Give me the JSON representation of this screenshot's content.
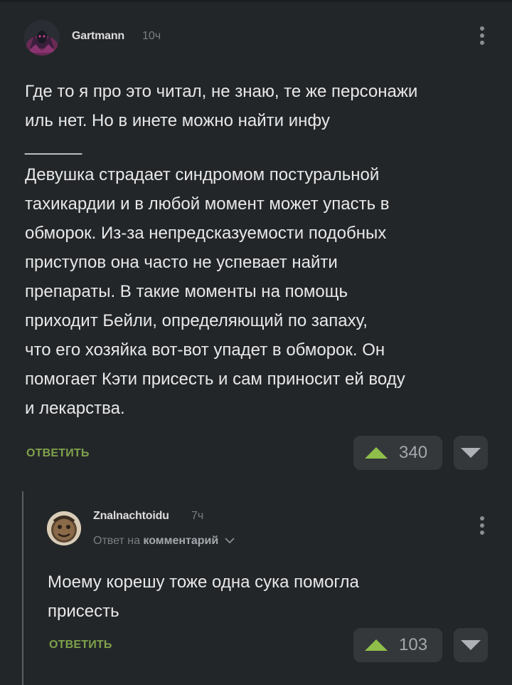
{
  "colors": {
    "background": "#232629",
    "accent_green": "#7fa14b",
    "vote_button_bg": "#34383b",
    "thread_line": "#5a5e61"
  },
  "comments": [
    {
      "author": "Gartmann",
      "time": "10ч",
      "body": [
        "Где то я про это читал, не знаю, те же персонажи",
        "иль нет. Но в инете можно найти инфу",
        "______",
        "Девушка страдает синдромом постуральной",
        "тахикардии и в любой момент может упасть в",
        "обморок. Из-за непредсказуемости подобных",
        "приступов она часто не успевает найти",
        "препараты. В такие моменты на помощь",
        "приходит Бейли, определяющий по запаху,",
        "что его хозяйка вот-вот упадет в обморок. Он",
        "помогает Кэти присесть и сам приносит ей воду",
        "и лекарства."
      ],
      "reply_label": "ОТВЕТИТЬ",
      "rating": "340",
      "menu_icon": "more-vertical-icon"
    },
    {
      "author": "Znalnachtoidu",
      "time": "7ч",
      "reply_to_prefix": "Ответ на",
      "reply_to_target": "комментарий",
      "body": [
        "Моему корешу тоже одна сука помогла",
        "присесть"
      ],
      "reply_label": "ОТВЕТИТЬ",
      "rating": "103",
      "menu_icon": "more-vertical-icon"
    }
  ]
}
